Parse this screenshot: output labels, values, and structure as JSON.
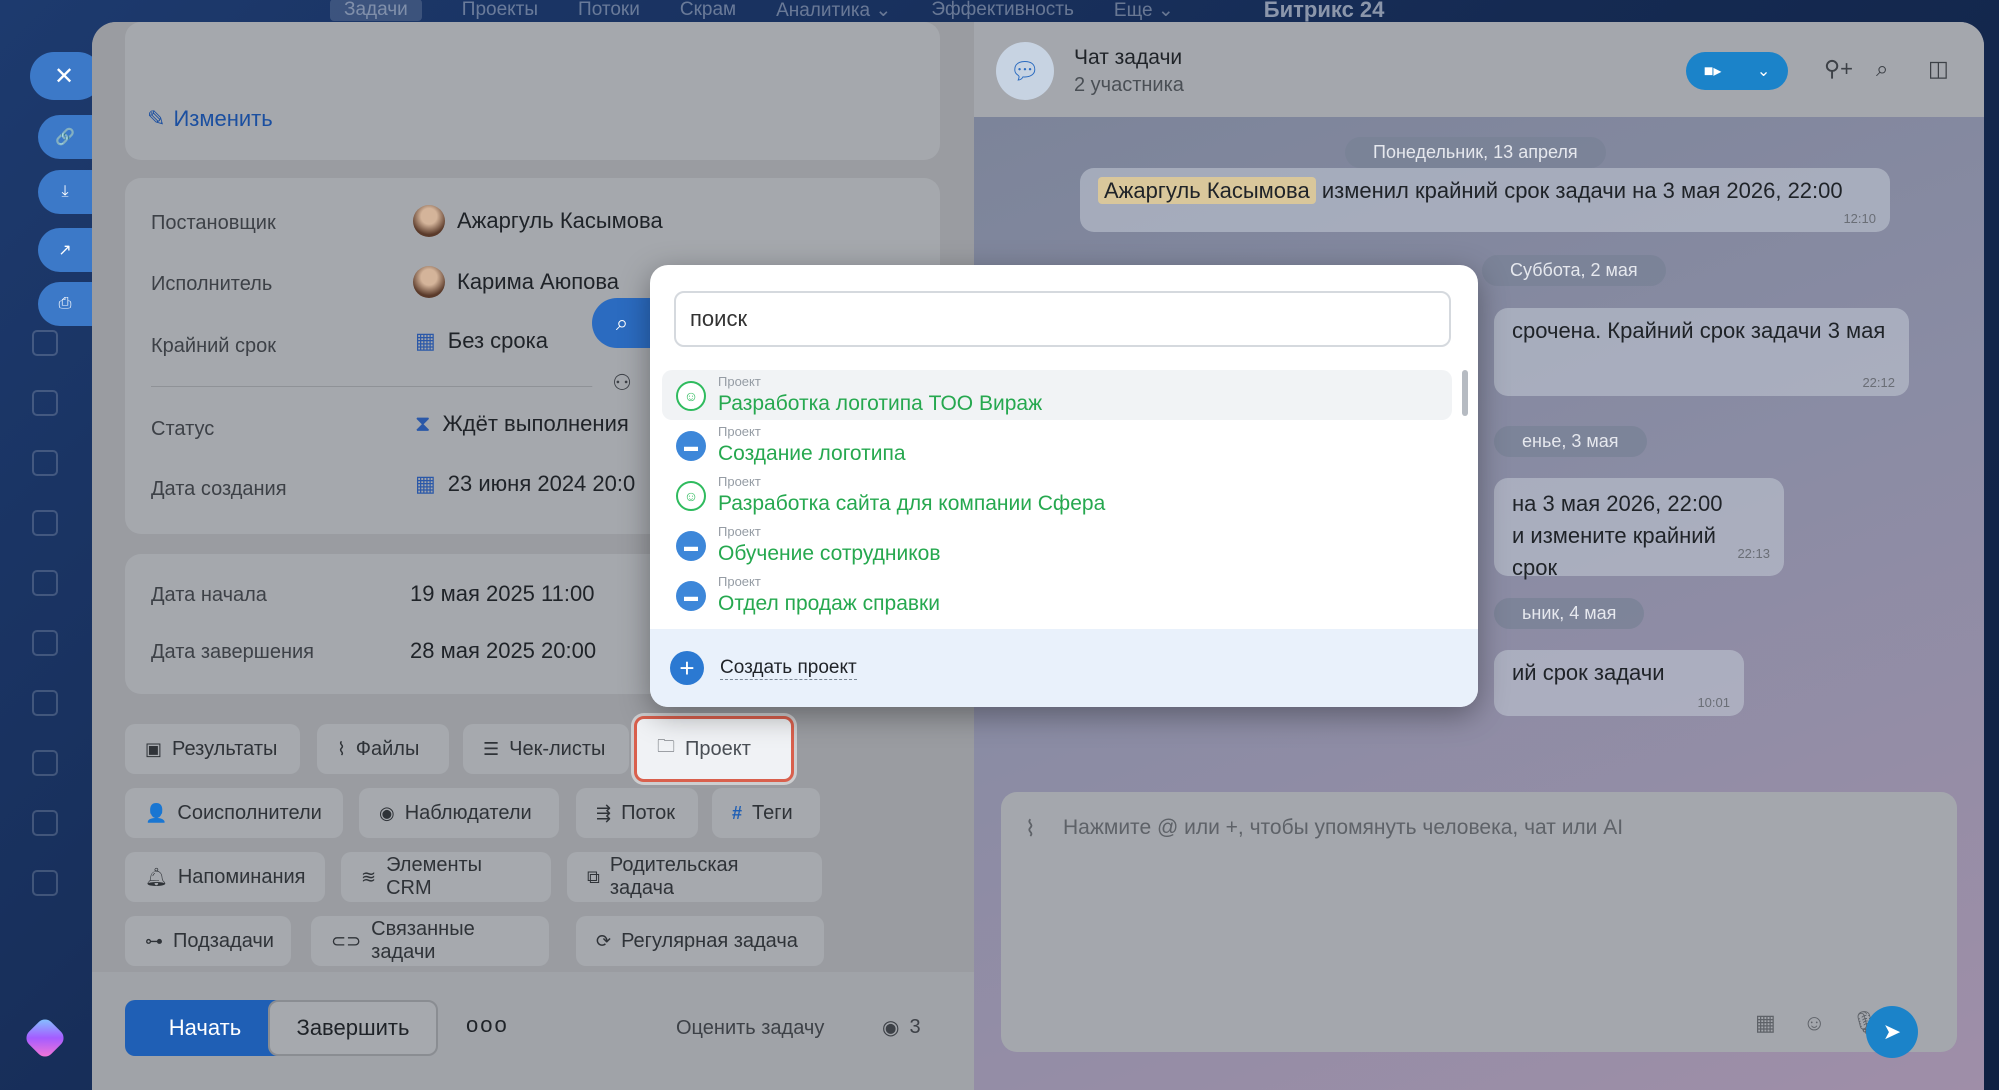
{
  "topnav": {
    "items": [
      "Задачи",
      "Проекты",
      "Потоки",
      "Скрам",
      "Аналитика ⌄",
      "Эффективность",
      "Еще ⌄"
    ],
    "brand": "Битрикс 24"
  },
  "task": {
    "edit_label": "Изменить",
    "fields": {
      "creator_label": "Постановщик",
      "creator_value": "Ажаргуль Касымова",
      "assignee_label": "Исполнитель",
      "assignee_value": "Карима Аюпова",
      "deadline_label": "Крайний срок",
      "deadline_value": "Без срока",
      "status_label": "Статус",
      "status_value": "Ждёт выполнения",
      "created_label": "Дата создания",
      "created_value": "23 июня 2024 20:0"
    },
    "dates": {
      "start_label": "Дата начала",
      "start_value": "19 мая 2025 11:00",
      "end_label": "Дата завершения",
      "end_value": "28 мая 2025 20:00"
    },
    "chips": [
      "Результаты",
      "Файлы",
      "Чек-листы",
      "Проект",
      "Соисполнители",
      "Наблюдатели",
      "Поток",
      "Теги",
      "Напоминания",
      "Элементы CRM",
      "Родительская задача",
      "Подзадачи",
      "Связанные задачи",
      "Регулярная задача"
    ],
    "footer": {
      "start": "Начать",
      "finish": "Завершить",
      "more": "ooo",
      "rate": "Оценить задачу",
      "views": "3"
    }
  },
  "chat": {
    "title": "Чат задачи",
    "subtitle": "2 участника",
    "day1": "Понедельник, 13 апреля",
    "msg1_mention": "Ажаргуль Касымова",
    "msg1_text": "изменил крайний срок задачи на 3 мая 2026, 22:00",
    "msg1_time": "12:10",
    "day2": "Суббота, 2 мая",
    "msg2_text": "срочена. Крайний срок задачи 3 мая",
    "msg2_time": "22:12",
    "day3": "енье, 3 мая",
    "msg3_line1": "на 3 мая 2026, 22:00",
    "msg3_line2": "и измените крайний срок",
    "msg3_time": "22:13",
    "day4": "ьник, 4 мая",
    "msg4_text": "ий срок задачи",
    "msg4_time": "10:01",
    "composer_placeholder": "Нажмите @ или +, чтобы упомянуть человека, чат или AI"
  },
  "popup": {
    "search_value": "поиск",
    "items": [
      {
        "category": "Проект",
        "name": "Разработка логотипа ТОО Вираж",
        "icon": "group-icon"
      },
      {
        "category": "Проект",
        "name": "Создание логотипа",
        "icon": "folder-icon"
      },
      {
        "category": "Проект",
        "name": "Разработка сайта для компании Сфера",
        "icon": "group-icon"
      },
      {
        "category": "Проект",
        "name": "Обучение сотрудников",
        "icon": "folder-icon"
      },
      {
        "category": "Проект",
        "name": "Отдел продаж справки",
        "icon": "folder-icon"
      }
    ],
    "create_label": "Создать проект"
  },
  "colors": {
    "accent": "#1f5fb5",
    "project_green": "#26a84f",
    "highlight": "#d9604d"
  }
}
